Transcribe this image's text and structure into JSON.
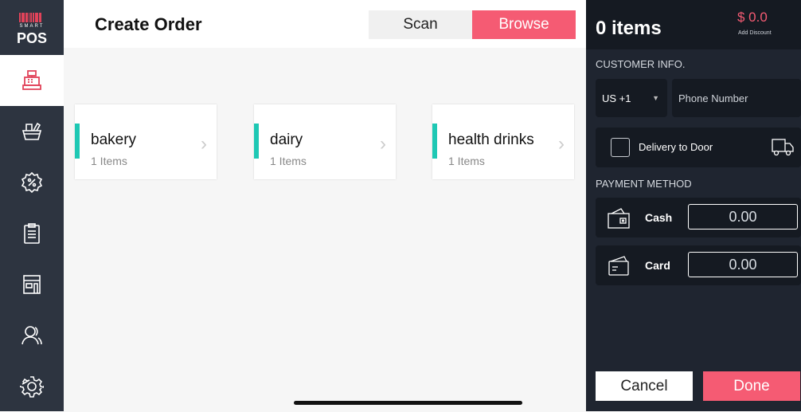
{
  "sidebar": {
    "logo_small": "SMART",
    "logo_big": "POS",
    "items": [
      {
        "icon": "cash-register-icon"
      },
      {
        "icon": "basket-icon"
      },
      {
        "icon": "discount-icon"
      },
      {
        "icon": "clipboard-icon"
      },
      {
        "icon": "store-icon"
      },
      {
        "icon": "user-icon"
      },
      {
        "icon": "gear-icon"
      }
    ]
  },
  "header": {
    "title": "Create Order",
    "tabs": {
      "scan": "Scan",
      "browse": "Browse"
    }
  },
  "categories": [
    {
      "name": "bakery",
      "count": "1 Items"
    },
    {
      "name": "dairy",
      "count": "1 Items"
    },
    {
      "name": "health drinks",
      "count": "1 Items"
    }
  ],
  "order": {
    "items_label": "0 items",
    "total": "$ 0.0",
    "add_discount": "Add Discount",
    "customer_section": "CUSTOMER INFO.",
    "country_code": "US +1",
    "phone_placeholder": "Phone Number",
    "delivery_label": "Delivery to Door",
    "payment_section": "PAYMENT METHOD",
    "cash_label": "Cash",
    "cash_amount": "0.00",
    "card_label": "Card",
    "card_amount": "0.00",
    "cancel": "Cancel",
    "done": "Done"
  },
  "colors": {
    "accent": "#f55b73",
    "teal": "#1ec8b4",
    "sidebar": "#2d3440",
    "panel": "#1f2530"
  }
}
